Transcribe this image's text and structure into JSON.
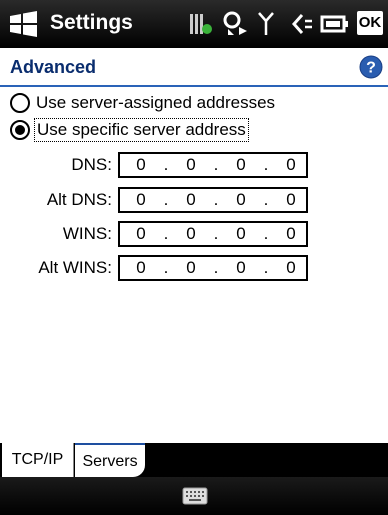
{
  "app": {
    "title": "Settings",
    "ok_label": "OK",
    "status_icons": [
      "bluetooth-icon",
      "connectivity-icon",
      "signal-icon",
      "volume-icon",
      "battery-icon"
    ]
  },
  "page": {
    "title": "Advanced",
    "help_icon": "help-icon"
  },
  "server_options": {
    "option_auto": "Use server-assigned addresses",
    "option_specific": "Use specific server address",
    "selected": "option_specific"
  },
  "fields": [
    {
      "label": "DNS:",
      "octets": [
        "0",
        "0",
        "0",
        "0"
      ]
    },
    {
      "label": "Alt DNS:",
      "octets": [
        "0",
        "0",
        "0",
        "0"
      ]
    },
    {
      "label": "WINS:",
      "octets": [
        "0",
        "0",
        "0",
        "0"
      ]
    },
    {
      "label": "Alt WINS:",
      "octets": [
        "0",
        "0",
        "0",
        "0"
      ]
    }
  ],
  "tabs": [
    {
      "label": "TCP/IP",
      "active": false
    },
    {
      "label": "Servers",
      "active": true
    }
  ],
  "menubar": {
    "center_icon": "keyboard-icon"
  },
  "colors": {
    "title_text": "#0a2d6e",
    "header_line": "#2a63b8",
    "help_blue": "#2a5db0"
  }
}
